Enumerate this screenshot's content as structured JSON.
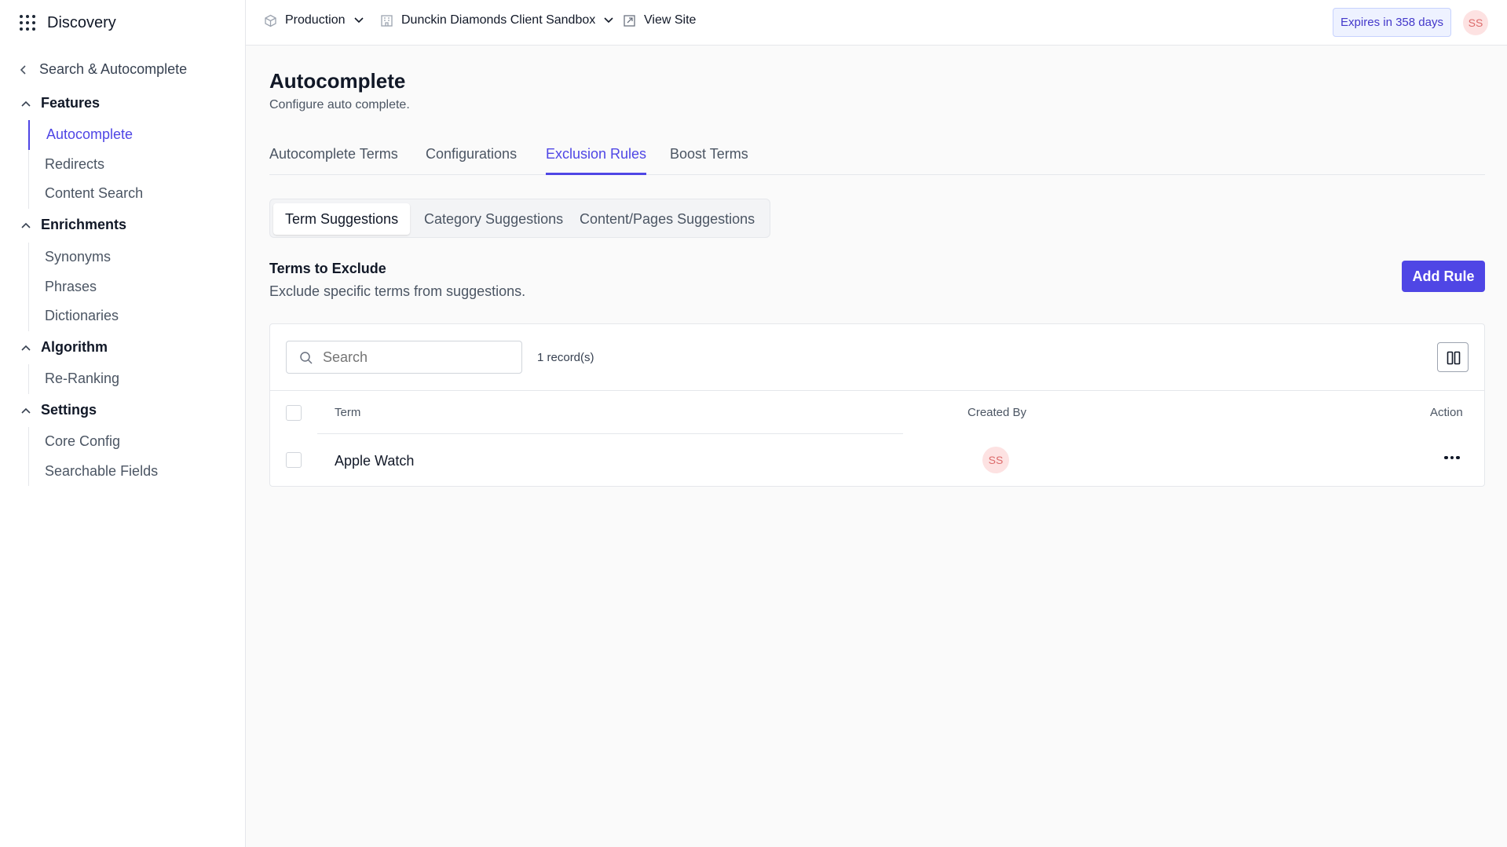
{
  "app": {
    "name": "Discovery",
    "icon": "apps-grid-icon"
  },
  "sidebar": {
    "back_label": "Search & Autocomplete",
    "sections": [
      {
        "title": "Features",
        "items": [
          {
            "label": "Autocomplete",
            "active": true
          },
          {
            "label": "Redirects"
          },
          {
            "label": "Content Search"
          }
        ]
      },
      {
        "title": "Enrichments",
        "items": [
          {
            "label": "Synonyms"
          },
          {
            "label": "Phrases"
          },
          {
            "label": "Dictionaries"
          }
        ]
      },
      {
        "title": "Algorithm",
        "items": [
          {
            "label": "Re-Ranking"
          }
        ]
      },
      {
        "title": "Settings",
        "items": [
          {
            "label": "Core Config"
          },
          {
            "label": "Searchable Fields"
          }
        ]
      }
    ]
  },
  "topbar": {
    "environment": "Production",
    "site": "Dunckin Diamonds Client Sandbox",
    "view_site": "View Site",
    "expires": "Expires in 358 days",
    "user_initials": "SS"
  },
  "page": {
    "title": "Autocomplete",
    "subtitle": "Configure auto complete.",
    "tabs": [
      {
        "label": "Autocomplete Terms"
      },
      {
        "label": "Configurations"
      },
      {
        "label": "Exclusion Rules",
        "active": true
      },
      {
        "label": "Boost Terms"
      }
    ],
    "segments": [
      {
        "label": "Term Suggestions",
        "active": true
      },
      {
        "label": "Category Suggestions"
      },
      {
        "label": "Content/Pages Suggestions"
      }
    ],
    "section_title": "Terms to Exclude",
    "section_subtitle": "Exclude specific terms from suggestions.",
    "add_button": "Add Rule"
  },
  "table": {
    "search_placeholder": "Search",
    "record_count": "1 record(s)",
    "columns": [
      "Term",
      "Created By",
      "Action"
    ],
    "rows": [
      {
        "term": "Apple Watch",
        "created_by": "SS"
      }
    ]
  },
  "colors": {
    "accent": "#4f46e5",
    "avatar_bg": "#fde2e2",
    "avatar_text": "#dc6b6b",
    "expires_bg": "#eef2ff"
  }
}
